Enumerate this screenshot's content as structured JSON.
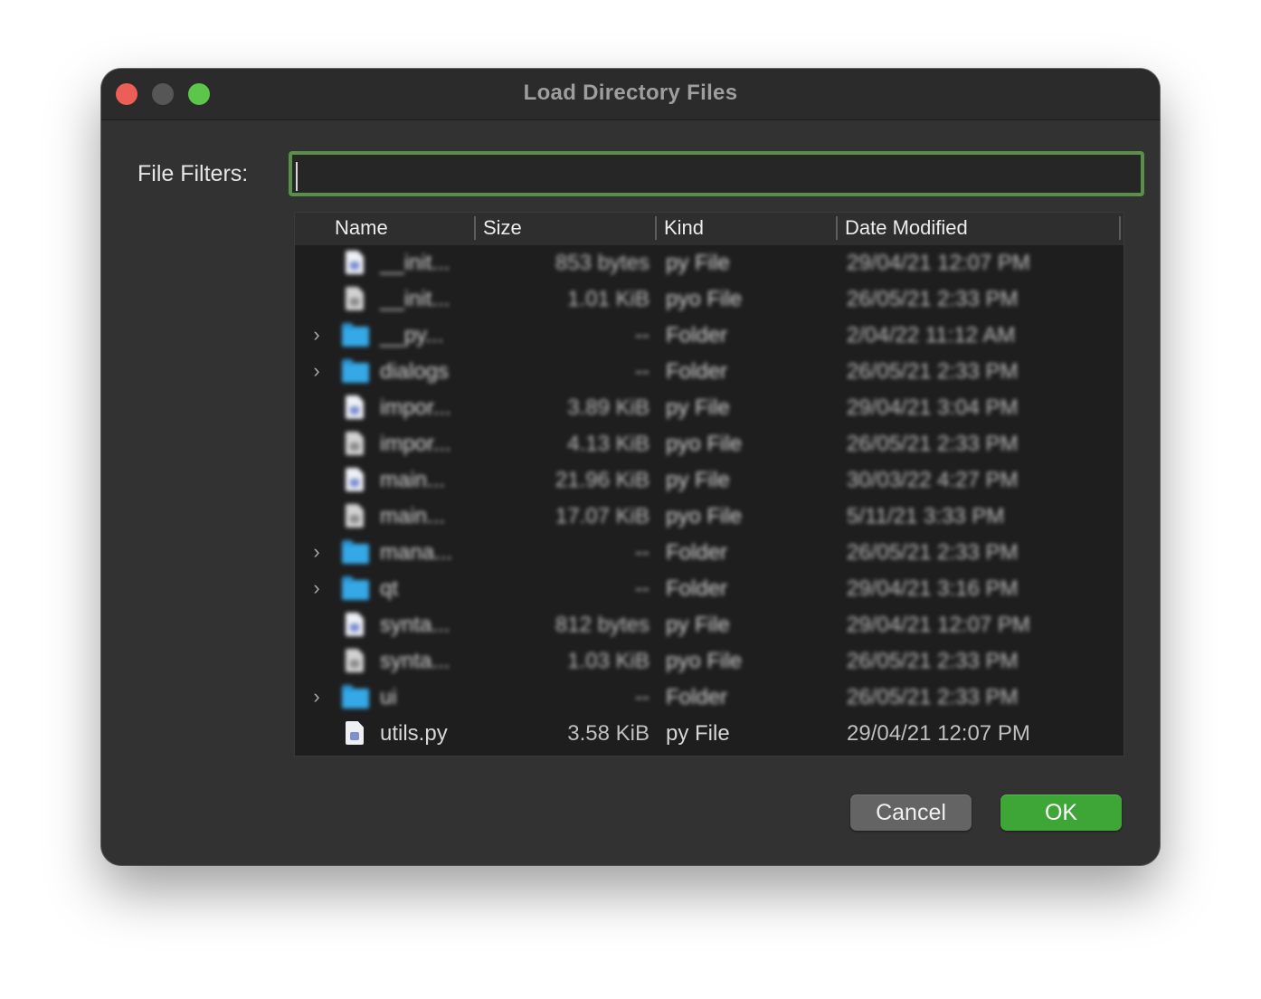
{
  "window": {
    "title": "Load Directory Files"
  },
  "filter": {
    "label": "File Filters:",
    "value": ""
  },
  "table": {
    "columns": [
      "Name",
      "Size",
      "Kind",
      "Date Modified"
    ],
    "rows": [
      {
        "name": "__init...",
        "size": "853 bytes",
        "kind": "py File",
        "date": "29/04/21 12:07 PM",
        "type": "py",
        "expandable": false
      },
      {
        "name": "__init...",
        "size": "1.01 KiB",
        "kind": "pyo File",
        "date": "26/05/21 2:33 PM",
        "type": "pyo",
        "expandable": false
      },
      {
        "name": "__py...",
        "size": "--",
        "kind": "Folder",
        "date": "2/04/22 11:12 AM",
        "type": "folder",
        "expandable": true
      },
      {
        "name": "dialogs",
        "size": "--",
        "kind": "Folder",
        "date": "26/05/21 2:33 PM",
        "type": "folder",
        "expandable": true
      },
      {
        "name": "impor...",
        "size": "3.89 KiB",
        "kind": "py File",
        "date": "29/04/21 3:04 PM",
        "type": "py",
        "expandable": false
      },
      {
        "name": "impor...",
        "size": "4.13 KiB",
        "kind": "pyo File",
        "date": "26/05/21 2:33 PM",
        "type": "pyo",
        "expandable": false
      },
      {
        "name": "main...",
        "size": "21.96 KiB",
        "kind": "py File",
        "date": "30/03/22 4:27 PM",
        "type": "py",
        "expandable": false
      },
      {
        "name": "main...",
        "size": "17.07 KiB",
        "kind": "pyo File",
        "date": "5/11/21 3:33 PM",
        "type": "pyo",
        "expandable": false
      },
      {
        "name": "mana...",
        "size": "--",
        "kind": "Folder",
        "date": "26/05/21 2:33 PM",
        "type": "folder",
        "expandable": true
      },
      {
        "name": "qt",
        "size": "--",
        "kind": "Folder",
        "date": "29/04/21 3:16 PM",
        "type": "folder",
        "expandable": true
      },
      {
        "name": "synta...",
        "size": "812 bytes",
        "kind": "py File",
        "date": "29/04/21 12:07 PM",
        "type": "py",
        "expandable": false
      },
      {
        "name": "synta...",
        "size": "1.03 KiB",
        "kind": "pyo File",
        "date": "26/05/21 2:33 PM",
        "type": "pyo",
        "expandable": false
      },
      {
        "name": "ui",
        "size": "--",
        "kind": "Folder",
        "date": "26/05/21 2:33 PM",
        "type": "folder",
        "expandable": true
      },
      {
        "name": "utils.py",
        "size": "3.58 KiB",
        "kind": "py File",
        "date": "29/04/21 12:07 PM",
        "type": "py",
        "expandable": false
      }
    ]
  },
  "buttons": {
    "cancel": "Cancel",
    "ok": "OK"
  },
  "colors": {
    "accent_green": "#3ea537",
    "focus_ring": "#5a8f4a",
    "folder_blue": "#35a8e6",
    "close_red": "#ec5f57",
    "maximize_green": "#5ec54b"
  }
}
